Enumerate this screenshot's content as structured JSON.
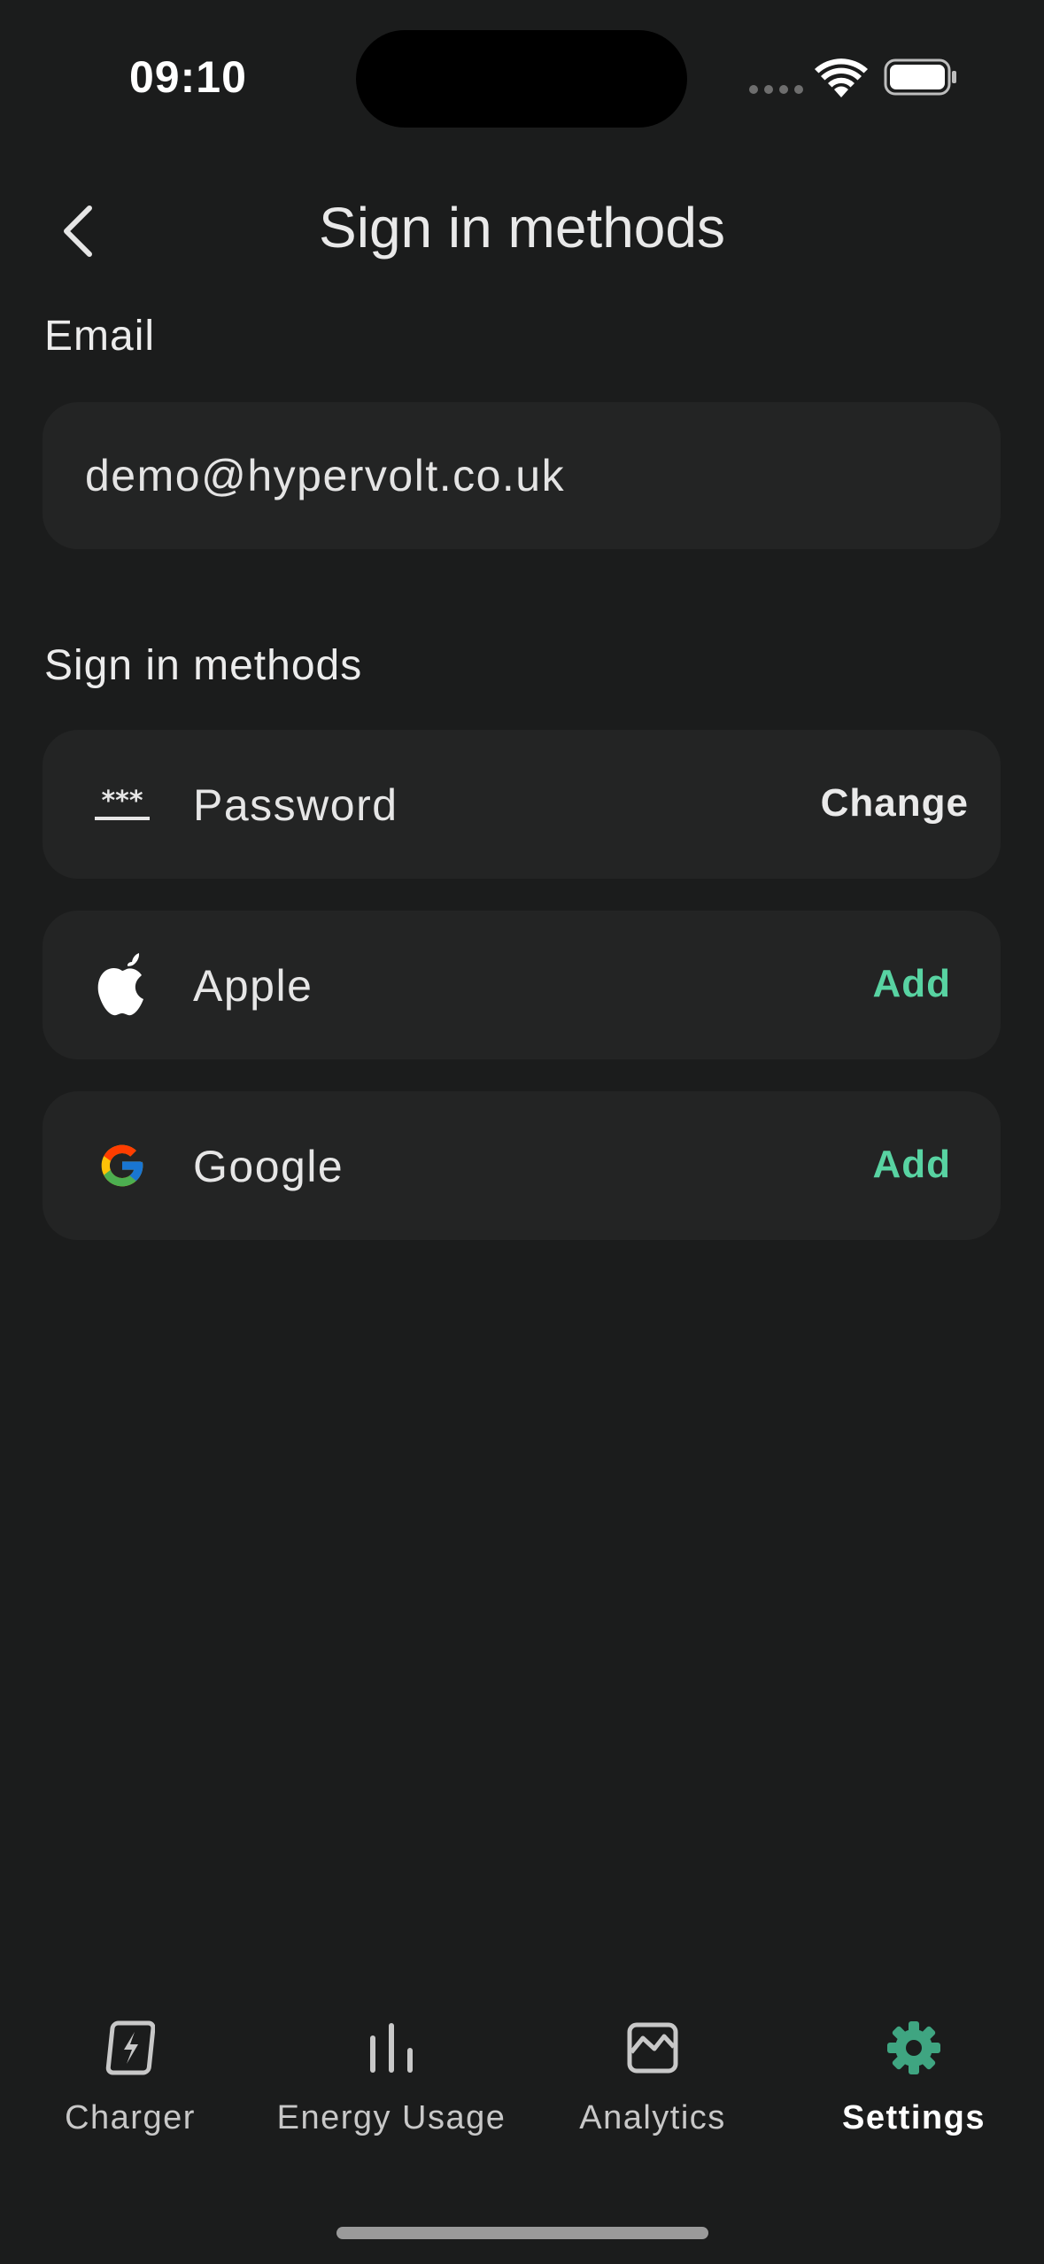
{
  "status_bar": {
    "time": "09:10"
  },
  "header": {
    "title": "Sign in methods"
  },
  "email_section": {
    "label": "Email",
    "value": "demo@hypervolt.co.uk"
  },
  "methods_section": {
    "label": "Sign in methods",
    "items": [
      {
        "label": "Password",
        "icon": "password-icon",
        "action": "Change"
      },
      {
        "label": "Apple",
        "icon": "apple-icon",
        "action": "Add"
      },
      {
        "label": "Google",
        "icon": "google-icon",
        "action": "Add"
      }
    ]
  },
  "bottom_nav": {
    "items": [
      {
        "label": "Charger",
        "icon": "charger-icon",
        "active": false
      },
      {
        "label": "Energy Usage",
        "icon": "energy-usage-icon",
        "active": false
      },
      {
        "label": "Analytics",
        "icon": "analytics-icon",
        "active": false
      },
      {
        "label": "Settings",
        "icon": "gear-icon",
        "active": true
      }
    ]
  },
  "colors": {
    "background": "#1b1c1c",
    "card": "#232424",
    "accent": "#58d3a2",
    "settings_active": "#3fa581"
  }
}
